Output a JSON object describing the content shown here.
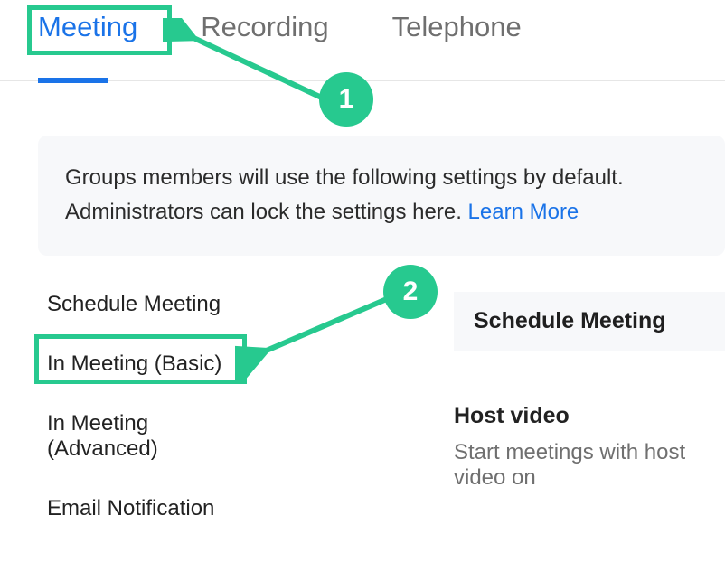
{
  "tabs": {
    "meeting": "Meeting",
    "recording": "Recording",
    "telephone": "Telephone"
  },
  "info": {
    "text": "Groups members will use the following settings by default. Administrators can lock the settings here. ",
    "link": "Learn More"
  },
  "sidenav": {
    "schedule": "Schedule Meeting",
    "basic": "In Meeting (Basic)",
    "advanced": "In Meeting (Advanced)",
    "email": "Email Notification"
  },
  "right": {
    "section_header": "Schedule Meeting",
    "setting_title": "Host video",
    "setting_sub": "Start meetings with host video on"
  },
  "annotations": {
    "badge1": "1",
    "badge2": "2"
  }
}
